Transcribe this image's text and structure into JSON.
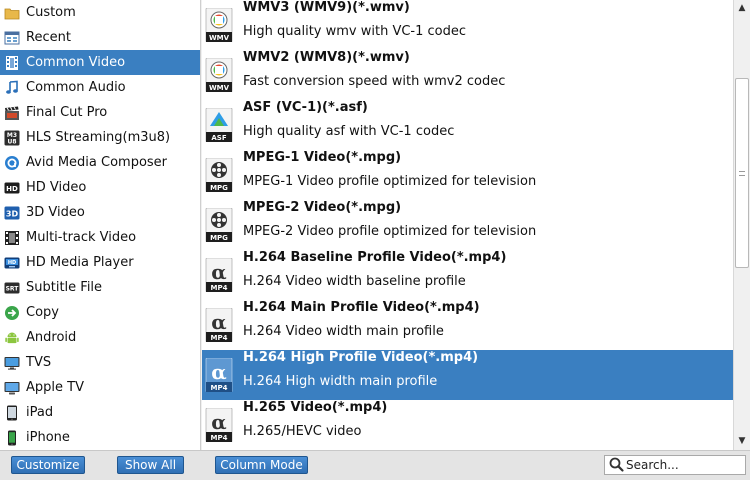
{
  "categories": [
    {
      "label": "Custom",
      "icon": "folder-icon"
    },
    {
      "label": "Recent",
      "icon": "recent-icon"
    },
    {
      "label": "Common Video",
      "icon": "film-icon",
      "selected": true
    },
    {
      "label": "Common Audio",
      "icon": "music-note-icon"
    },
    {
      "label": "Final Cut Pro",
      "icon": "clapperboard-icon"
    },
    {
      "label": "HLS Streaming(m3u8)",
      "icon": "m3u8-icon"
    },
    {
      "label": "Avid Media Composer",
      "icon": "avid-icon"
    },
    {
      "label": "HD Video",
      "icon": "hd-icon"
    },
    {
      "label": "3D Video",
      "icon": "3d-icon"
    },
    {
      "label": "Multi-track Video",
      "icon": "filmstrip-icon"
    },
    {
      "label": "HD Media Player",
      "icon": "media-player-icon"
    },
    {
      "label": "Subtitle File",
      "icon": "subtitle-icon"
    },
    {
      "label": "Copy",
      "icon": "copy-icon"
    },
    {
      "label": "Android",
      "icon": "android-icon"
    },
    {
      "label": "TVS",
      "icon": "tv-icon"
    },
    {
      "label": "Apple TV",
      "icon": "apple-tv-icon"
    },
    {
      "label": "iPad",
      "icon": "ipad-icon"
    },
    {
      "label": "iPhone",
      "icon": "iphone-icon"
    }
  ],
  "formats": [
    {
      "title": "WMV3 (WMV9)(*.wmv)",
      "desc": "High quality wmv with VC-1 codec",
      "icon": "wmv-icon",
      "badge": "WMV"
    },
    {
      "title": "WMV2 (WMV8)(*.wmv)",
      "desc": "Fast conversion speed with wmv2 codec",
      "icon": "wmv-icon",
      "badge": "WMV"
    },
    {
      "title": "ASF (VC-1)(*.asf)",
      "desc": "High quality asf with VC-1 codec",
      "icon": "asf-icon",
      "badge": "ASF"
    },
    {
      "title": "MPEG-1 Video(*.mpg)",
      "desc": "MPEG-1 Video profile optimized for television",
      "icon": "mpg-icon",
      "badge": "MPG"
    },
    {
      "title": "MPEG-2 Video(*.mpg)",
      "desc": "MPEG-2 Video profile optimized for television",
      "icon": "mpg-icon",
      "badge": "MPG"
    },
    {
      "title": "H.264 Baseline Profile Video(*.mp4)",
      "desc": "H.264 Video width baseline profile",
      "icon": "mp4-icon",
      "badge": "MP4"
    },
    {
      "title": "H.264 Main Profile Video(*.mp4)",
      "desc": "H.264 Video width main profile",
      "icon": "mp4-icon",
      "badge": "MP4"
    },
    {
      "title": "H.264 High Profile Video(*.mp4)",
      "desc": "H.264 High width main profile",
      "icon": "mp4-icon",
      "badge": "MP4",
      "selected": true
    },
    {
      "title": "H.265 Video(*.mp4)",
      "desc": "H.265/HEVC video",
      "icon": "mp4-icon",
      "badge": "MP4"
    }
  ],
  "buttons": {
    "customize": "Customize",
    "show_all": "Show All",
    "column_mode": "Column Mode"
  },
  "search": {
    "placeholder": "Search...",
    "value": ""
  },
  "colors": {
    "selection": "#3a7fc1",
    "button": "#3a7fc1"
  }
}
